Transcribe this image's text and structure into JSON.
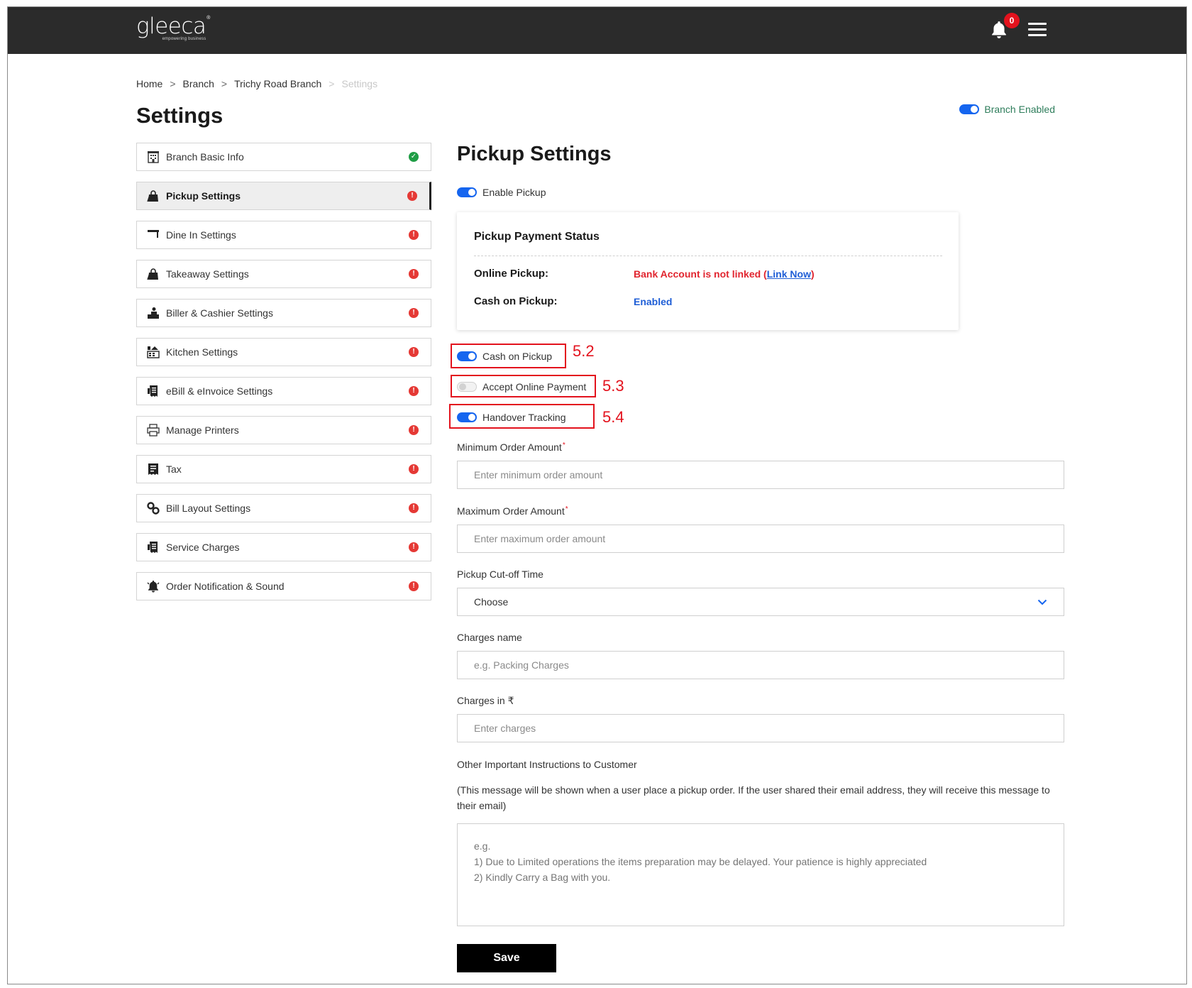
{
  "header": {
    "logo_text": "gleeca",
    "logo_reg": "®",
    "logo_tagline": "empowering business",
    "notification_count": "0"
  },
  "breadcrumb": {
    "items": [
      "Home",
      "Branch",
      "Trichy Road Branch",
      "Settings"
    ],
    "separator": ">"
  },
  "page_title": "Settings",
  "branch_toggle": {
    "label": "Branch Enabled",
    "on": true
  },
  "sidebar": {
    "items": [
      {
        "label": "Branch Basic Info",
        "icon": "building-icon",
        "status": "ok"
      },
      {
        "label": "Pickup Settings",
        "icon": "shopping-bag-icon",
        "status": "warn",
        "active": true
      },
      {
        "label": "Dine In Settings",
        "icon": "table-icon",
        "status": "warn"
      },
      {
        "label": "Takeaway Settings",
        "icon": "takeaway-bag-icon",
        "status": "warn"
      },
      {
        "label": "Biller & Cashier Settings",
        "icon": "cashier-icon",
        "status": "warn"
      },
      {
        "label": "Kitchen Settings",
        "icon": "kitchen-icon",
        "status": "warn"
      },
      {
        "label": "eBill & eInvoice Settings",
        "icon": "receipt-icon",
        "status": "warn"
      },
      {
        "label": "Manage Printers",
        "icon": "printer-icon",
        "status": "warn"
      },
      {
        "label": "Tax",
        "icon": "tax-receipt-icon",
        "status": "warn"
      },
      {
        "label": "Bill Layout Settings",
        "icon": "gears-icon",
        "status": "warn"
      },
      {
        "label": "Service Charges",
        "icon": "service-receipt-icon",
        "status": "warn"
      },
      {
        "label": "Order Notification & Sound",
        "icon": "bell-icon",
        "status": "warn"
      }
    ],
    "status_ok_glyph": "✓",
    "status_warn_glyph": "!"
  },
  "main": {
    "title": "Pickup Settings",
    "enable_pickup": {
      "label": "Enable Pickup",
      "on": true
    },
    "payment_status": {
      "title": "Pickup Payment Status",
      "online_label": "Online Pickup:",
      "online_value": "Bank Account is not linked (",
      "online_link": "Link Now",
      "online_value_end": ")",
      "cash_label": "Cash on Pickup:",
      "cash_value": "Enabled"
    },
    "options": [
      {
        "label": "Cash on Pickup",
        "on": true,
        "annotation": "5.2"
      },
      {
        "label": "Accept Online Payment",
        "on": false,
        "annotation": "5.3"
      },
      {
        "label": "Handover Tracking",
        "on": true,
        "annotation": "5.4"
      }
    ],
    "fields": {
      "min_order": {
        "label": "Minimum Order Amount",
        "required_mark": "*",
        "placeholder": "Enter minimum order amount"
      },
      "max_order": {
        "label": "Maximum Order Amount",
        "required_mark": "*",
        "placeholder": "Enter maximum order amount"
      },
      "cutoff": {
        "label": "Pickup Cut-off Time",
        "value": "Choose"
      },
      "charges_name": {
        "label": "Charges name",
        "placeholder": "e.g. Packing Charges"
      },
      "charges": {
        "label": "Charges in ₹",
        "placeholder": "Enter charges"
      },
      "instructions": {
        "label": "Other Important Instructions to Customer",
        "helper": "(This message will be shown when a user place a pickup order. If the user shared their email address, they will receive this message to their email)",
        "placeholder": "e.g.\n1) Due to Limited operations the items preparation may be delayed. Your patience is highly appreciated\n2) Kindly Carry a Bag with you."
      }
    },
    "save_label": "Save"
  },
  "colors": {
    "header_bg": "#2b2b2b",
    "accent_blue": "#1565ef",
    "danger_red": "#e1252f",
    "success_green": "#1f9d45",
    "annotation_red": "#e3121d"
  }
}
